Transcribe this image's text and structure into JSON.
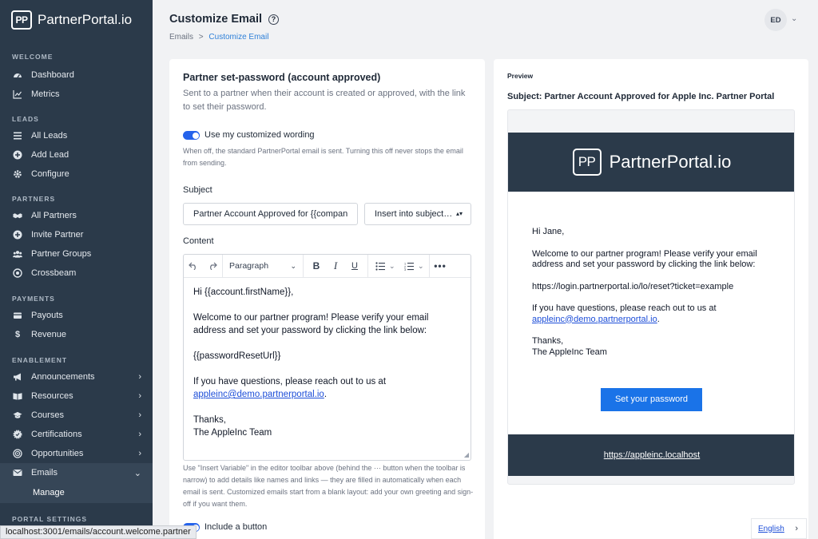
{
  "sidebar": {
    "logo_mark": "PP",
    "logo_text": "PartnerPortal.io",
    "sections": {
      "welcome": "WELCOME",
      "leads": "LEADS",
      "partners": "PARTNERS",
      "payments": "PAYMENTS",
      "enablement": "ENABLEMENT",
      "portal_settings": "PORTAL SETTINGS"
    },
    "items": {
      "dashboard": "Dashboard",
      "metrics": "Metrics",
      "all_leads": "All Leads",
      "add_lead": "Add Lead",
      "configure": "Configure",
      "all_partners": "All Partners",
      "invite_partner": "Invite Partner",
      "partner_groups": "Partner Groups",
      "crossbeam": "Crossbeam",
      "payouts": "Payouts",
      "revenue": "Revenue",
      "announcements": "Announcements",
      "resources": "Resources",
      "courses": "Courses",
      "certifications": "Certifications",
      "opportunities": "Opportunities",
      "emails": "Emails",
      "manage": "Manage"
    }
  },
  "header": {
    "title": "Customize Email",
    "breadcrumb_root": "Emails",
    "breadcrumb_sep": ">",
    "breadcrumb_current": "Customize Email",
    "avatar_initials": "ED"
  },
  "editor": {
    "title": "Partner set-password (account approved)",
    "description": "Sent to a partner when their account is created or approved, with the link to set their password.",
    "toggle_label": "Use my customized wording",
    "toggle_note": "When off, the standard PartnerPortal email is sent. Turning this off never stops the email from sending.",
    "subject_label": "Subject",
    "subject_value": "Partner Account Approved for {{company.name}} Partner Portal",
    "insert_subject_label": "Insert into subject…",
    "content_label": "Content",
    "paragraph_label": "Paragraph",
    "body": {
      "greeting": "Hi {{account.firstName}},",
      "welcome": "Welcome to our partner program! Please verify your email address and set your password by clicking the link below:",
      "reset_var": "{{passwordResetUrl}}",
      "questions": "If you have questions, please reach out to us at",
      "email_link": "appleinc@demo.partnerportal.io",
      "period": ".",
      "thanks": "Thanks,",
      "signoff": "The AppleInc Team"
    },
    "hint": "Use \"Insert Variable\" in the editor toolbar above (behind the ··· button when the toolbar is narrow) to add details like names and links — they are filled in automatically when each email is sent. Customized emails start from a blank layout: add your own greeting and sign-off if you want them.",
    "include_button_label": "Include a button"
  },
  "preview": {
    "label": "Preview",
    "subject_prefix": "Subject:",
    "subject": "Partner Account Approved for Apple Inc. Partner Portal",
    "logo_mark": "PP",
    "logo_text": "PartnerPortal.io",
    "greeting": "Hi Jane,",
    "welcome": "Welcome to our partner program! Please verify your email address and set your password by clicking the link below:",
    "reset_url": "https://login.partnerportal.io/lo/reset?ticket=example",
    "questions": "If you have questions, please reach out to us at",
    "email_link": "appleinc@demo.partnerportal.io",
    "period": ".",
    "thanks": "Thanks,",
    "signoff": "The AppleInc Team",
    "cta_label": "Set your password",
    "footer_link": "https://appleinc.localhost"
  },
  "status_bar": "localhost:3001/emails/account.welcome.partner",
  "language": "English",
  "colors": {
    "sidebar_bg": "#2b3a4a",
    "accent": "#2563eb",
    "cta": "#1a73e8",
    "link": "#1d4ed8"
  }
}
